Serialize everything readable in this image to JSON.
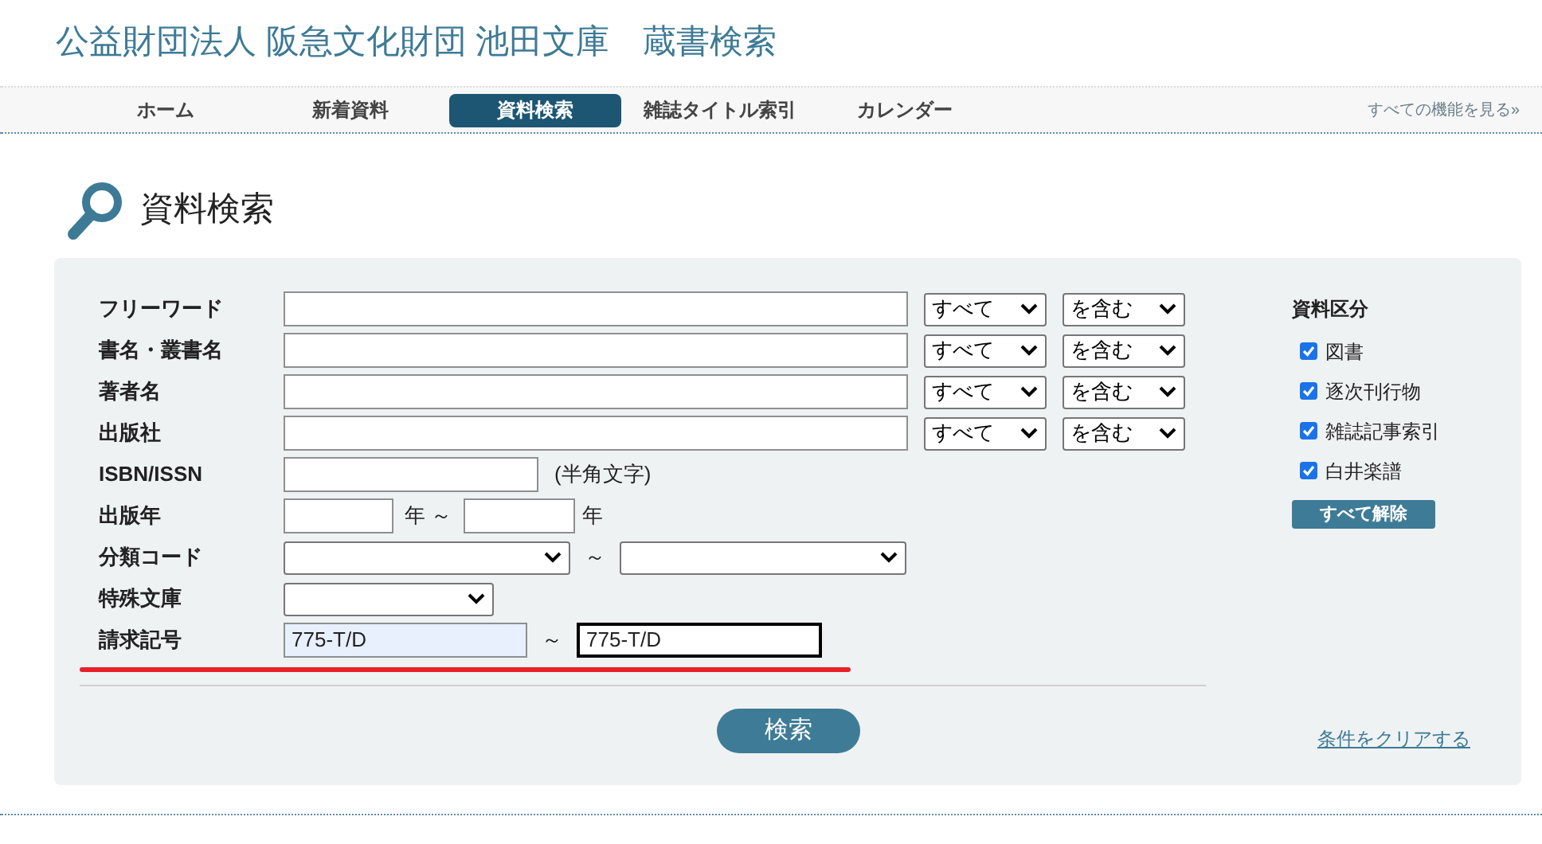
{
  "site_title": "公益財団法人 阪急文化財団 池田文庫　蔵書検索",
  "nav": {
    "items": [
      {
        "label": "ホーム",
        "selected": false
      },
      {
        "label": "新着資料",
        "selected": false
      },
      {
        "label": "資料検索",
        "selected": true
      },
      {
        "label": "雑誌タイトル索引",
        "selected": false
      },
      {
        "label": "カレンダー",
        "selected": false
      }
    ],
    "more_link": "すべての機能を見る»"
  },
  "page_heading": "資料検索",
  "form": {
    "rows": [
      {
        "kind": "keyword",
        "label": "フリーワード",
        "scope": "すべて",
        "match": "を含む"
      },
      {
        "kind": "keyword",
        "label": "書名・叢書名",
        "scope": "すべて",
        "match": "を含む"
      },
      {
        "kind": "keyword",
        "label": "著者名",
        "scope": "すべて",
        "match": "を含む"
      },
      {
        "kind": "keyword",
        "label": "出版社",
        "scope": "すべて",
        "match": "を含む"
      },
      {
        "kind": "isbn",
        "label": "ISBN/ISSN",
        "note": "(半角文字)"
      },
      {
        "kind": "year_range",
        "label": "出版年",
        "from_suffix": "年 ～",
        "to_suffix": "年"
      },
      {
        "kind": "select_range",
        "label": "分類コード",
        "separator": "～"
      },
      {
        "kind": "select",
        "label": "特殊文庫"
      },
      {
        "kind": "text_range",
        "label": "請求記号",
        "separator": "～",
        "from": {
          "value": "775-T/D",
          "autofilled": true
        },
        "to": {
          "value": "775-T/D",
          "focused": true
        }
      }
    ],
    "search_button": "検索"
  },
  "material_types": {
    "title": "資料区分",
    "items": [
      {
        "label": "図書",
        "checked": true
      },
      {
        "label": "逐次刊行物",
        "checked": true
      },
      {
        "label": "雑誌記事索引",
        "checked": true
      },
      {
        "label": "白井楽譜",
        "checked": true
      }
    ],
    "clear_all_button": "すべて解除"
  },
  "clear_conditions_link": "条件をクリアする"
}
